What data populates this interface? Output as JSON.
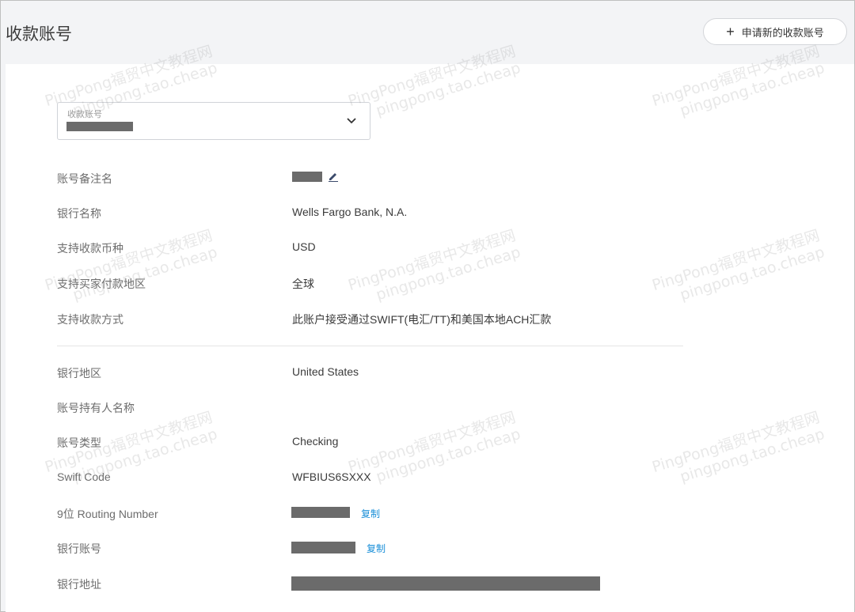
{
  "header": {
    "title": "收款账号",
    "add_button_label": "申请新的收款账号"
  },
  "account_select": {
    "label": "收款账号"
  },
  "details": {
    "remark": "账号备注名",
    "bank_name": {
      "label": "银行名称",
      "value": "Wells Fargo Bank, N.A."
    },
    "currency": {
      "label": "支持收款币种",
      "value": "USD"
    },
    "buyer_region": {
      "label": "支持买家付款地区",
      "value": "全球"
    },
    "method": {
      "label": "支持收款方式",
      "value": "此账户接受通过SWIFT(电汇/TT)和美国本地ACH汇款"
    },
    "bank_region": {
      "label": "银行地区",
      "value": "United States"
    },
    "holder_name": {
      "label": "账号持有人名称"
    },
    "account_type": {
      "label": "账号类型",
      "value": "Checking"
    },
    "swift_code": {
      "label": "Swift Code",
      "value": "WFBIUS6SXXX"
    },
    "routing": {
      "label": "9位 Routing Number",
      "copy": "复制"
    },
    "bank_account": {
      "label": "银行账号",
      "copy": "复制"
    },
    "bank_address": {
      "label": "银行地址"
    }
  },
  "watermark": {
    "line1": "PingPong福贸中文教程网",
    "line2": "pingpong.tao.cheap"
  },
  "colors": {
    "background": "#f3f4f6",
    "card": "#ffffff",
    "link": "#1a8fd8",
    "redaction": "#6b6b6b"
  }
}
